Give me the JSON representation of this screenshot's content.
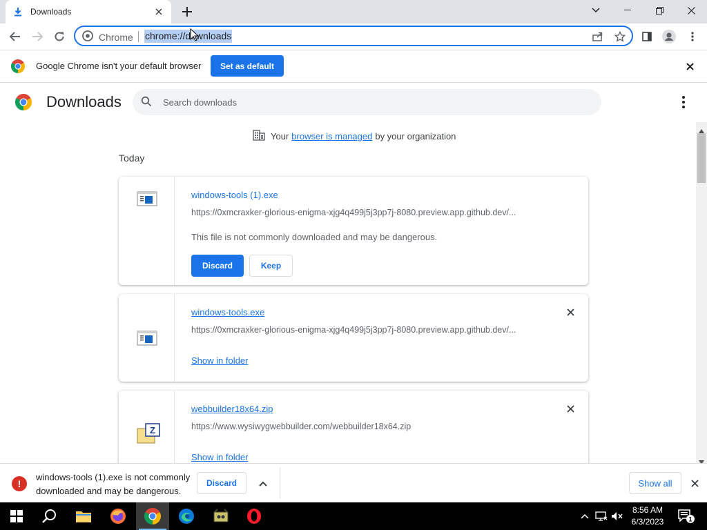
{
  "tab": {
    "title": "Downloads"
  },
  "omnibox": {
    "site_label": "Chrome",
    "url": "chrome://downloads"
  },
  "infobar": {
    "message": "Google Chrome isn't your default browser",
    "button": "Set as default"
  },
  "page": {
    "title": "Downloads",
    "search_placeholder": "Search downloads",
    "managed": {
      "prefix": "Your",
      "link": "browser is managed",
      "suffix": "by your organization"
    },
    "section_date": "Today"
  },
  "downloads": [
    {
      "name": "windows-tools (1).exe",
      "url": "https://0xmcraxker-glorious-enigma-xjg4q499j5j3pp7j-8080.preview.app.github.dev/...",
      "warning": "This file is not commonly downloaded and may be dangerous.",
      "discard_label": "Discard",
      "keep_label": "Keep"
    },
    {
      "name": "windows-tools.exe",
      "url": "https://0xmcraxker-glorious-enigma-xjg4q499j5j3pp7j-8080.preview.app.github.dev/...",
      "action_label": "Show in folder"
    },
    {
      "name": "webbuilder18x64.zip",
      "url": "https://www.wysiwygwebbuilder.com/webbuilder18x64.zip",
      "action_label": "Show in folder"
    }
  ],
  "shelf": {
    "message": "windows-tools (1).exe is not commonly downloaded and may be dangerous.",
    "discard_label": "Discard",
    "show_all_label": "Show all"
  },
  "taskbar": {
    "apps": [
      "start-icon",
      "search-icon",
      "file-explorer-icon",
      "firefox-icon",
      "chrome-icon",
      "edge-icon",
      "app-icon",
      "opera-icon"
    ],
    "time": "8:56 AM",
    "date": "6/3/2023",
    "notification_count": "1"
  },
  "colors": {
    "accent": "#1a73e8",
    "danger": "#d93025",
    "tabstrip": "#dee1e6"
  }
}
